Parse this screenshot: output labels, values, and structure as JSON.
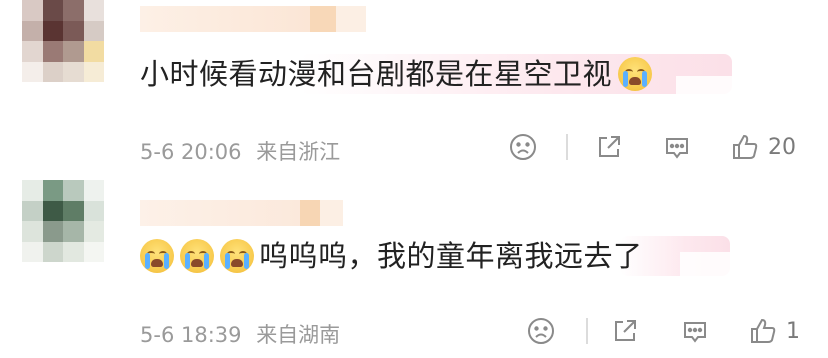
{
  "comments": [
    {
      "text": "小时候看动漫和台剧都是在星空卫视",
      "time": "5-6 20:06",
      "location": "来自浙江",
      "like_count": "20",
      "trailing_emoji": "crying-face"
    },
    {
      "leading_emojis": [
        "crying-face",
        "crying-face",
        "crying-face"
      ],
      "text": "呜呜呜，我的童年离我远去了",
      "time": "5-6 18:39",
      "location": "来自湖南",
      "like_count": "1"
    }
  ],
  "colors": {
    "text": "#222222",
    "meta": "#9a9a9a",
    "icon": "#8a8a8a",
    "highlight": "#fde8ee",
    "name_blur": "#f7d6b4"
  },
  "icons": [
    "sad-face-icon",
    "share-icon",
    "comment-icon",
    "thumbs-up-icon"
  ]
}
